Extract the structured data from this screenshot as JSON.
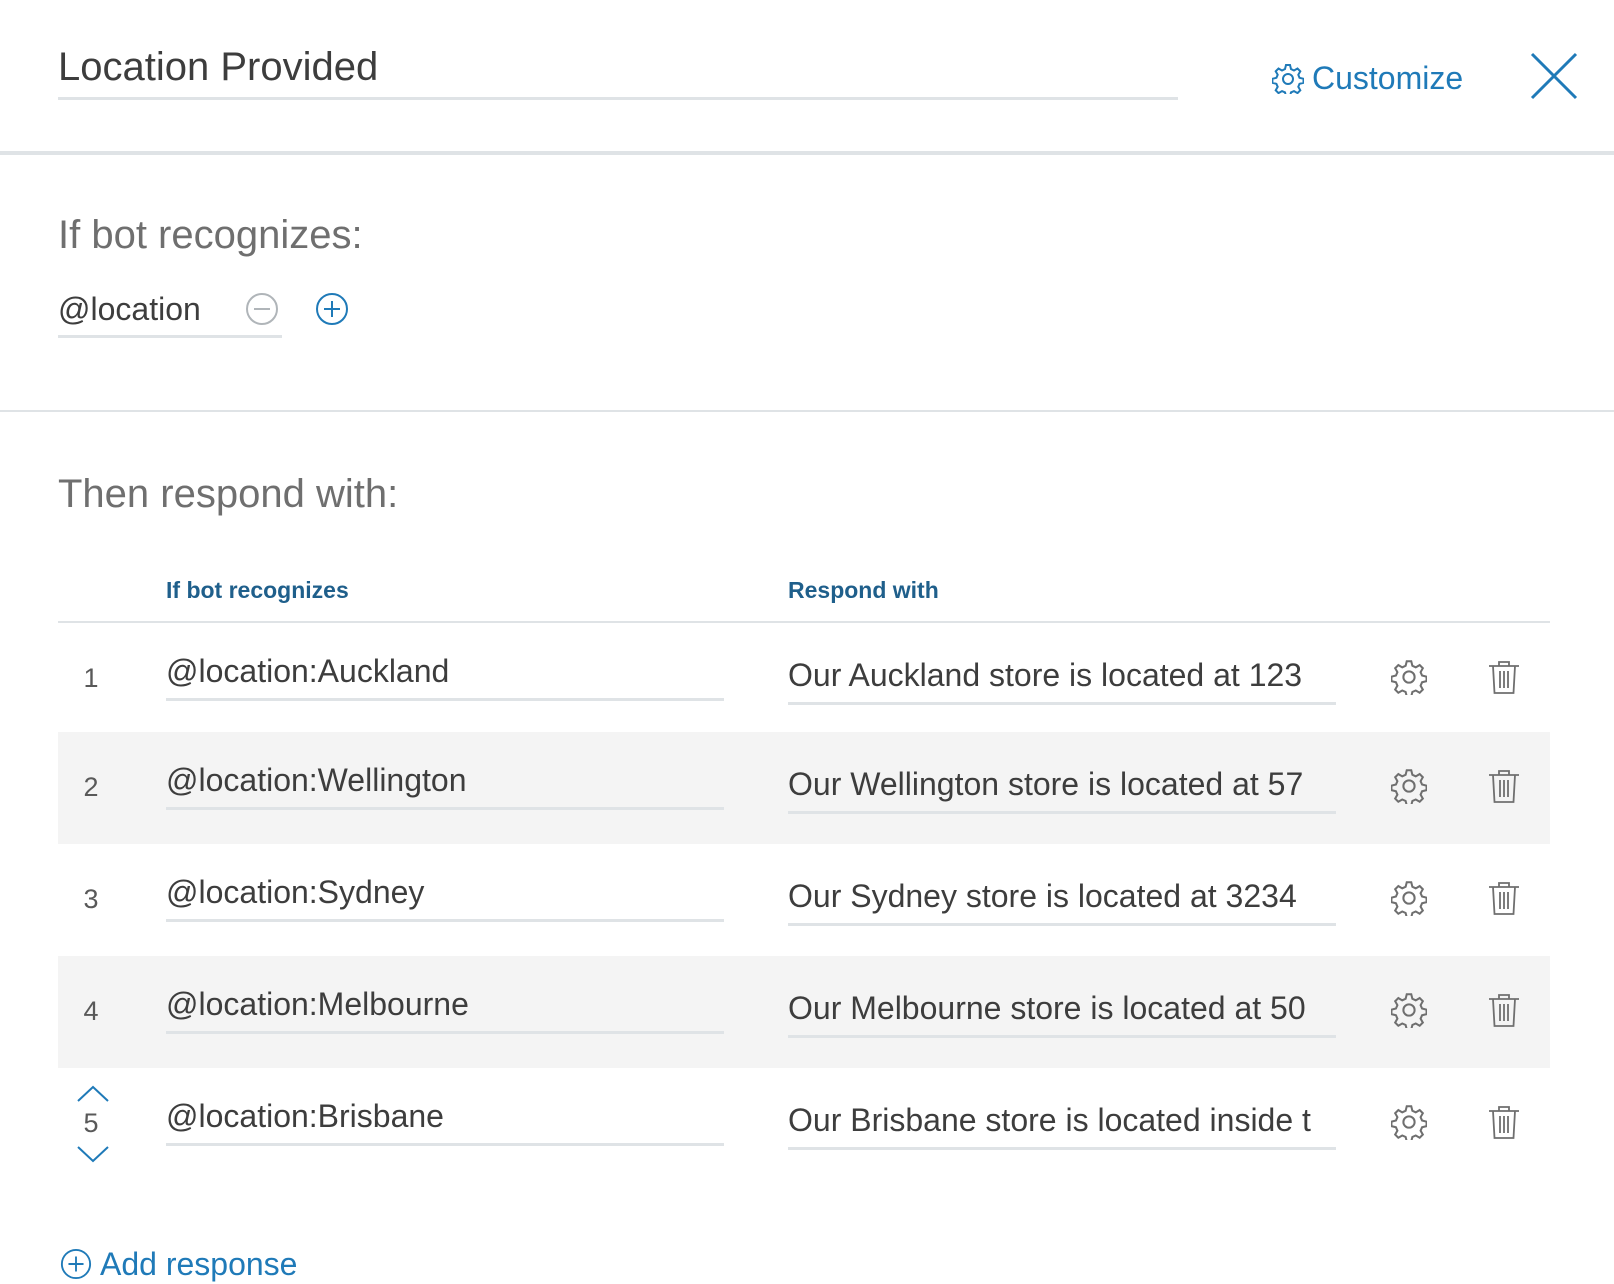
{
  "header": {
    "node_name": "Location Provided",
    "customize_label": "Customize"
  },
  "condition": {
    "section_title": "If bot recognizes:",
    "value": "@location"
  },
  "responses": {
    "section_title": "Then respond with:",
    "col_condition": "If bot recognizes",
    "col_response": "Respond with",
    "rows": [
      {
        "num": "1",
        "condition": "@location:Auckland",
        "response": "Our Auckland store is located at 123"
      },
      {
        "num": "2",
        "condition": "@location:Wellington",
        "response": "Our Wellington store is located at 57"
      },
      {
        "num": "3",
        "condition": "@location:Sydney",
        "response": "Our Sydney store is located at 3234"
      },
      {
        "num": "4",
        "condition": "@location:Melbourne",
        "response": "Our Melbourne store is located at 50"
      },
      {
        "num": "5",
        "condition": "@location:Brisbane",
        "response": "Our Brisbane store is located inside t"
      }
    ],
    "add_label": "Add response"
  },
  "colors": {
    "accent": "#1f7ab8",
    "header_text": "#1f5f8b",
    "divider": "#dfe3e6",
    "row_alt": "#f4f4f4"
  }
}
